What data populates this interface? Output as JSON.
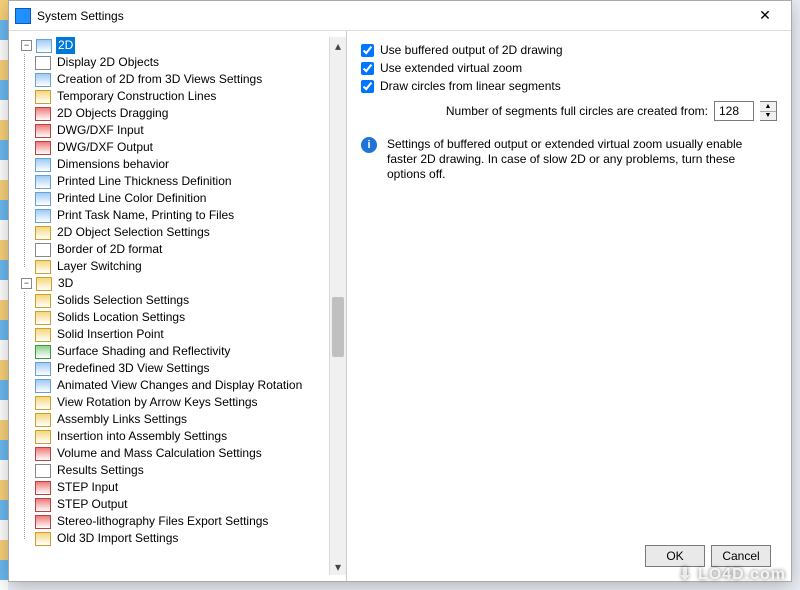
{
  "window": {
    "title": "System Settings",
    "close": "✕"
  },
  "tree": {
    "root2D": {
      "label": "2D",
      "expander": "−"
    },
    "items2D": [
      {
        "label": "Display 2D Objects"
      },
      {
        "label": "Creation of 2D from 3D Views Settings"
      },
      {
        "label": "Temporary Construction Lines"
      },
      {
        "label": "2D Objects Dragging"
      },
      {
        "label": "DWG/DXF Input"
      },
      {
        "label": "DWG/DXF Output"
      },
      {
        "label": "Dimensions behavior"
      },
      {
        "label": "Printed Line Thickness Definition"
      },
      {
        "label": "Printed Line Color Definition"
      },
      {
        "label": "Print Task Name, Printing to Files"
      },
      {
        "label": "2D Object Selection Settings"
      },
      {
        "label": "Border of 2D format"
      },
      {
        "label": "Layer Switching"
      }
    ],
    "root3D": {
      "label": "3D",
      "expander": "−"
    },
    "items3D": [
      {
        "label": "Solids Selection Settings"
      },
      {
        "label": "Solids Location Settings"
      },
      {
        "label": "Solid Insertion Point"
      },
      {
        "label": "Surface Shading and Reflectivity"
      },
      {
        "label": "Predefined 3D View Settings"
      },
      {
        "label": "Animated View Changes and Display Rotation"
      },
      {
        "label": "View Rotation by Arrow Keys Settings"
      },
      {
        "label": "Assembly Links Settings"
      },
      {
        "label": "Insertion into Assembly Settings"
      },
      {
        "label": "Volume and Mass Calculation Settings"
      },
      {
        "label": "Results Settings"
      },
      {
        "label": "STEP Input"
      },
      {
        "label": "STEP Output"
      },
      {
        "label": "Stereo-lithography Files Export Settings"
      },
      {
        "label": "Old 3D Import Settings"
      }
    ]
  },
  "settings": {
    "cb1": "Use buffered output of 2D drawing",
    "cb2": "Use extended virtual zoom",
    "cb3": "Draw circles from linear segments",
    "seg_label": "Number of segments full circles are created from:",
    "seg_value": "128",
    "info": "Settings of buffered output or extended virtual zoom usually enable faster 2D drawing. In case of slow 2D or any problems, turn these options off."
  },
  "buttons": {
    "ok": "OK",
    "cancel": "Cancel"
  },
  "watermark": "LO4D.com"
}
